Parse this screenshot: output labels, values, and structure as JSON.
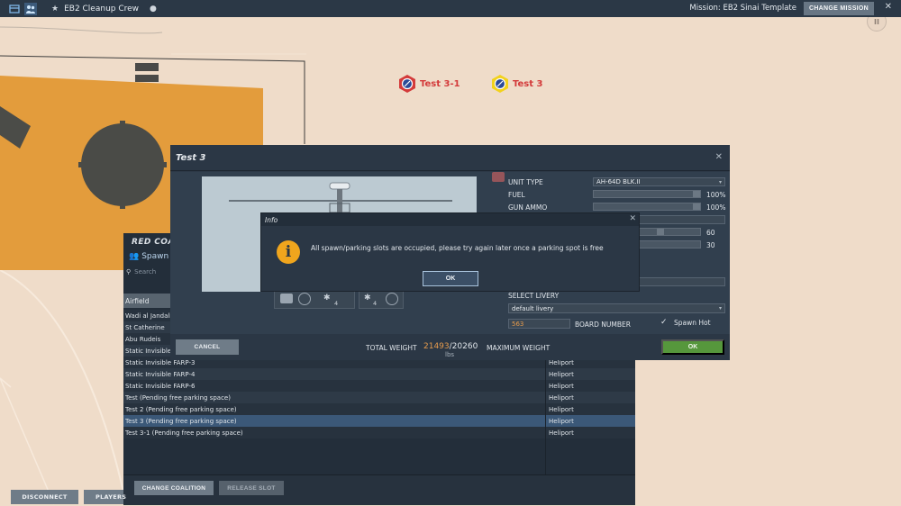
{
  "topbar": {
    "title": "EB2 Cleanup Crew",
    "mission": "Mission: EB2 Sinai Template",
    "change_mission": "CHANGE MISSION"
  },
  "map": {
    "units": [
      {
        "label": "Test 3-1",
        "color": "#d33a3a"
      },
      {
        "label": "Test 3",
        "color": "#d33a3a"
      }
    ]
  },
  "slots_panel": {
    "title": "RED COALITION",
    "subtitle": "Spawn slots",
    "search_placeholder": "Search",
    "columns": [
      "Airfield",
      ""
    ],
    "rows": [
      {
        "name": "Wadi al Jandali",
        "type": ""
      },
      {
        "name": "St Catherine",
        "type": ""
      },
      {
        "name": "Abu Rudeis",
        "type": ""
      },
      {
        "name": "Static Invisible FARP-1",
        "type": ""
      },
      {
        "name": "Static Invisible FARP-3",
        "type": "Heliport"
      },
      {
        "name": "Static Invisible FARP-4",
        "type": "Heliport"
      },
      {
        "name": "Static Invisible FARP-6",
        "type": "Heliport"
      },
      {
        "name": "Test (Pending free parking space)",
        "type": "Heliport"
      },
      {
        "name": "Test 2 (Pending free parking space)",
        "type": "Heliport"
      },
      {
        "name": "Test 3 (Pending free parking space)",
        "type": "Heliport",
        "selected": true
      },
      {
        "name": "Test 3-1 (Pending free parking space)",
        "type": "Heliport"
      }
    ],
    "change_coalition": "CHANGE COALITION",
    "release_slot": "RELEASE SLOT"
  },
  "bottom_buttons": {
    "disconnect": "DISCONNECT",
    "players": "PLAYERS"
  },
  "unit_dialog": {
    "title": "Test 3",
    "unit_type_label": "UNIT TYPE",
    "unit_type_value": "AH-64D BLK.II",
    "fuel_label": "FUEL",
    "fuel_value": "100%",
    "fuel_level": 1.0,
    "gun_ammo_label": "GUN AMMO",
    "gun_ammo_value": "100%",
    "gun_ammo_level": 1.0,
    "val_60": "60",
    "val_30": "30",
    "select_livery_label": "SELECT LIVERY",
    "livery_value": "default livery",
    "board_number_value": "563",
    "board_number_label": "BOARD NUMBER",
    "spawn_hot_label": "Spawn Hot",
    "spawn_hot_checked": true,
    "loadout_counts": [
      "4",
      "4"
    ],
    "cancel": "CANCEL",
    "total_weight_label": "TOTAL WEIGHT",
    "total_weight_value": "21493",
    "max_weight_value": "/20260",
    "weight_unit": "lbs",
    "maximum_weight_label": "MAXIMUM WEIGHT",
    "ok": "OK"
  },
  "info_modal": {
    "title": "Info",
    "message": "All spawn/parking slots are occupied, please try again later once a parking spot is free",
    "ok": "OK"
  }
}
